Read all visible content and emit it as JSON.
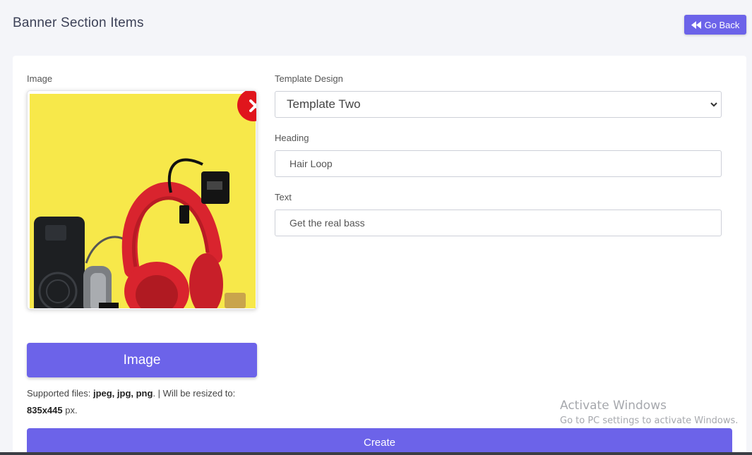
{
  "header": {
    "title": "Banner Section Items",
    "go_back_label": "Go Back"
  },
  "form": {
    "image_label": "Image",
    "image_button_label": "Image",
    "supported_prefix": "Supported files: ",
    "supported_types": "jpeg, jpg, png",
    "resize_note": ". | Will be resized to: ",
    "resize_dims": "835x445",
    "resize_unit": " px.",
    "template_label": "Template Design",
    "template_value": "Template Two",
    "heading_label": "Heading",
    "heading_value": "Hair Loop",
    "text_label": "Text",
    "text_value": "Get the real bass",
    "create_label": "Create"
  },
  "watermark": {
    "title": "Activate Windows",
    "subtitle": "Go to PC settings to activate Windows."
  },
  "colors": {
    "accent": "#6c63e9",
    "remove": "#e0151c",
    "image_bg": "#f7e84a",
    "headphones": "#d9242e"
  },
  "icons": [
    "rewind-icon",
    "close-icon",
    "chevron-down-icon"
  ]
}
